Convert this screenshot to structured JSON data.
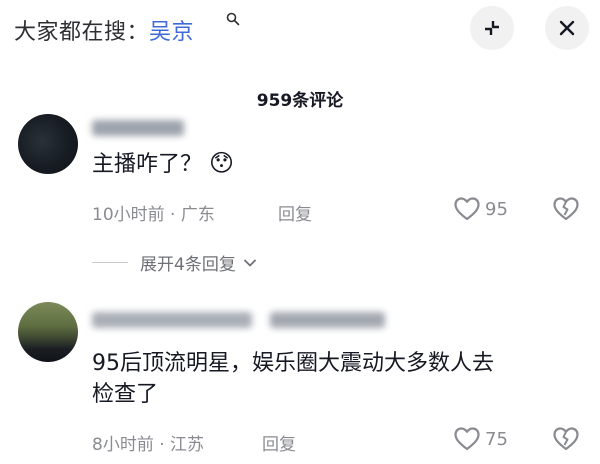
{
  "search": {
    "prefix": "大家都在搜：",
    "keyword": "吴京"
  },
  "comments_header": {
    "count_title": "959条评论"
  },
  "comments": [
    {
      "text": "主播咋了？",
      "emoji": "😯",
      "time_location": "10小时前 · 广东",
      "reply_label": "回复",
      "likes": "95",
      "expand_label": "展开4条回复"
    },
    {
      "text_line1": "95后顶流明星，娱乐圈大震动大多数人去",
      "text_line2": "检查了",
      "time_location": "8小时前 · 江苏",
      "reply_label": "回复",
      "likes": "75"
    }
  ],
  "icons": {
    "search": "search-icon",
    "collapse": "collapse-icon",
    "close": "close-icon",
    "like": "heart-icon",
    "dislike": "broken-heart-icon",
    "expand": "chevron-down-icon"
  },
  "colors": {
    "keyword": "#3f6ad8",
    "muted_text": "#8a8b91",
    "primary_text": "#161823"
  }
}
